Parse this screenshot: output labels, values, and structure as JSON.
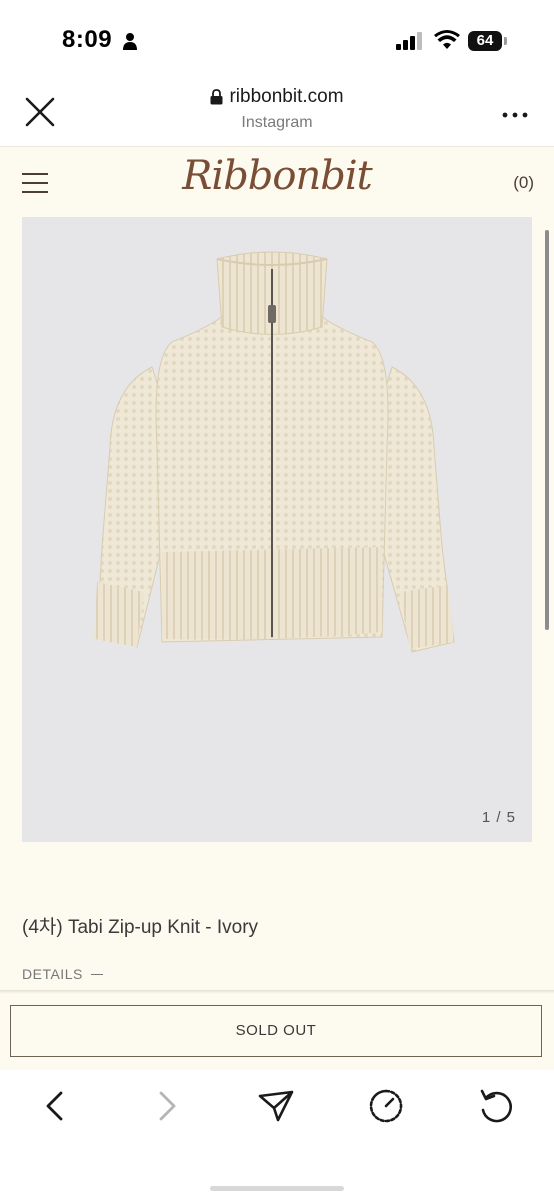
{
  "status_bar": {
    "time": "8:09",
    "battery_level": "64",
    "icons": [
      "person-icon",
      "signal-icon",
      "wifi-icon",
      "battery-icon"
    ]
  },
  "browser": {
    "domain": "ribbonbit.com",
    "source": "Instagram",
    "icons": [
      "close-icon",
      "lock-icon",
      "more-icon"
    ]
  },
  "site": {
    "logo": "Ribbonbit",
    "cart": "(0)",
    "icons": [
      "menu-icon"
    ]
  },
  "product": {
    "image_counter": "1 / 5",
    "title": "(4차) Tabi Zip-up Knit - Ivory",
    "details_label": "DETAILS",
    "sold_out_label": "SOLD OUT"
  },
  "toolbar": {
    "icons": [
      "back-icon",
      "forward-icon",
      "share-icon",
      "timer-icon",
      "reload-icon"
    ]
  },
  "colors": {
    "page_background": "#fdfaf0",
    "logo": "#7a4d35",
    "image_background": "#e6e6e8",
    "sweater": "#efe8d6"
  }
}
